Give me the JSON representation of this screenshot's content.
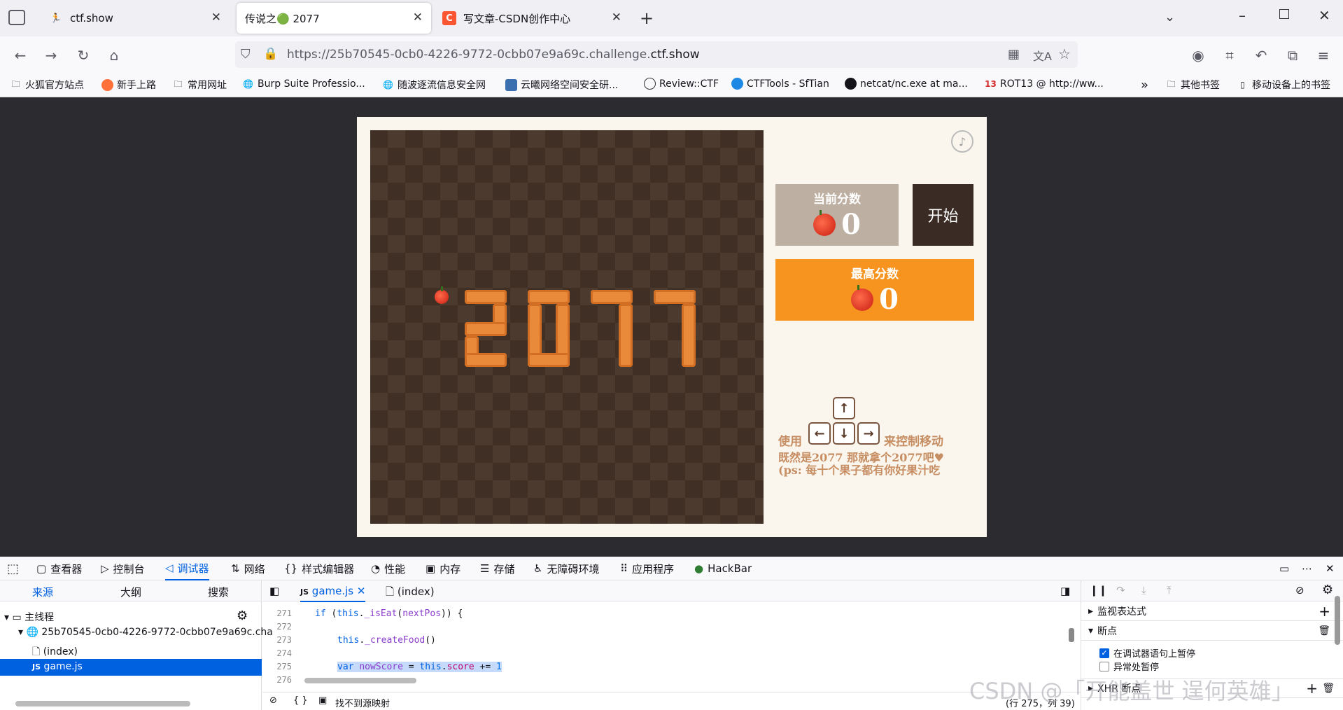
{
  "tabs": [
    {
      "title": "ctf.show",
      "icon": "person-run-icon"
    },
    {
      "title": "传说之🟢 2077",
      "icon": ""
    },
    {
      "title": "写文章-CSDN创作中心",
      "icon": "csdn-icon",
      "icon_letter": "C"
    }
  ],
  "url": {
    "prefix": "https://25b70545-0cb0-4226-9772-0cbb07e9a69c.challenge.",
    "domain": "ctf.show"
  },
  "bookmarks": [
    "火狐官方站点",
    "新手上路",
    "常用网址",
    "Burp Suite Professio...",
    "随波逐流信息安全网",
    "云曦网络空间安全研...",
    "Review::CTF",
    "CTFTools - SfTian",
    "netcat/nc.exe at ma...",
    "ROT13 @ http://ww...",
    "其他书签",
    "移动设备上的书签"
  ],
  "game": {
    "current_score_label": "当前分数",
    "current_score": "0",
    "high_score_label": "最高分数",
    "high_score": "0",
    "start_button": "开始",
    "hint_use": "使用",
    "hint_control": "来控制移动",
    "hint_line2": "既然是2077 那就拿个2077吧♥",
    "hint_line3": "(ps: 每十个果子都有你好果汁吃",
    "keys": {
      "up": "↑",
      "left": "←",
      "down": "↓",
      "right": "→"
    },
    "board_text": "2077"
  },
  "devtools": {
    "tabs": [
      "查看器",
      "控制台",
      "调试器",
      "网络",
      "样式编辑器",
      "性能",
      "内存",
      "存储",
      "无障碍环境",
      "应用程序",
      "HackBar"
    ],
    "active_tab": "调试器",
    "left_tabs": [
      "来源",
      "大纲",
      "搜索"
    ],
    "tree": {
      "main_thread": "主线程",
      "host": "25b70545-0cb0-4226-9772-0cbb07e9a69c.cha",
      "index": "(index)",
      "gamejs": "game.js"
    },
    "editor_tabs": [
      "game.js",
      "(index)"
    ],
    "code_lines": [
      {
        "no": "271",
        "text": "if (this._isEat(nextPos)) {"
      },
      {
        "no": "272",
        "text": ""
      },
      {
        "no": "273",
        "text": "this._createFood()"
      },
      {
        "no": "274",
        "text": ""
      },
      {
        "no": "275",
        "text": "var nowScore = this.score += 1"
      },
      {
        "no": "276",
        "text": ""
      }
    ],
    "status_no_sourcemap": "找不到源映射",
    "cursor_pos": "(行 275，列 39)",
    "right_sections": {
      "watch": "监视表达式",
      "breakpoints": "断点",
      "pause_on_debugger": "在调试器语句上暂停",
      "pause_on_exceptions": "异常处暂停",
      "xhr": "XHR 断点"
    }
  },
  "watermark": "CSDN @「开能盖世 逞何英雄」"
}
